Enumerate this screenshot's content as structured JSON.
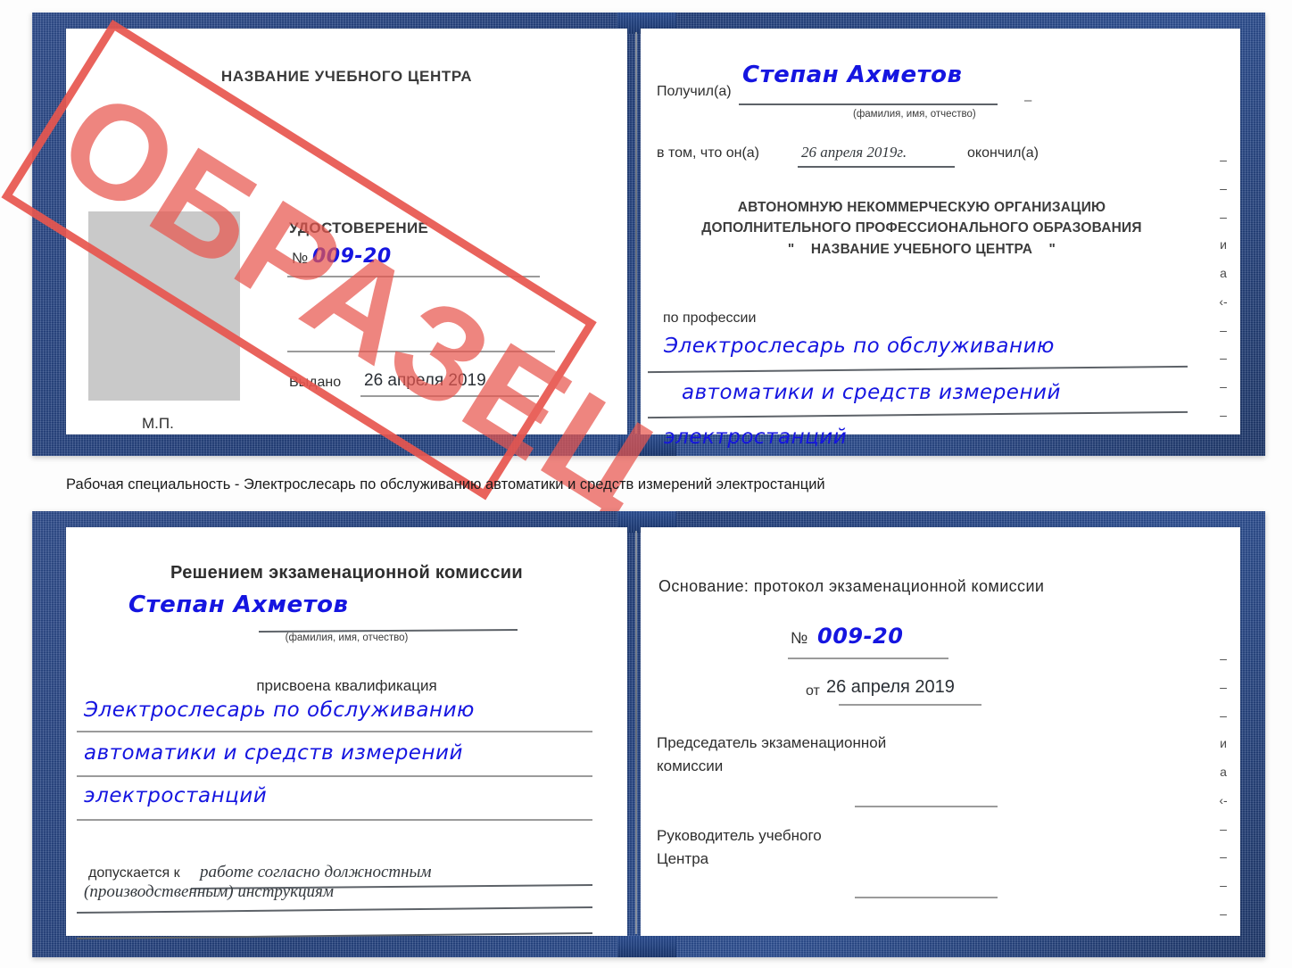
{
  "caption": {
    "text": "Рабочая специальность - Электрослесарь по обслуживанию автоматики и средств измерений электростанций"
  },
  "stamp": {
    "text": "ОБРАЗЕЦ",
    "color": "#e8564f"
  },
  "colors": {
    "cover_blue": "#1f3d7a",
    "ink_blue": "#1515e0",
    "paper_white": "#ffffff",
    "photo_gray": "#c9c9c9",
    "rule_gray": "#9b9b9b"
  },
  "certificate_top": {
    "left_page": {
      "center_name": "НАЗВАНИЕ УЧЕБНОГО ЦЕНТРА",
      "doc_type": "УДОСТОВЕРЕНИЕ",
      "number_prefix": "№",
      "number_value": "009-20",
      "issued_label": "Выдано",
      "issued_value": "26 апреля 2019",
      "seal_label": "М.П."
    },
    "right_page": {
      "received_label": "Получил(а)",
      "received_value": "Степан Ахметов",
      "fio_hint": "(фамилия, имя, отчество)",
      "in_that_label": "в том, что он(а)",
      "completion_date": "26 апреля 2019г.",
      "finished_label": "окончил(а)",
      "org_line1": "АВТОНОМНУЮ НЕКОММЕРЧЕСКУЮ ОРГАНИЗАЦИЮ",
      "org_line2": "ДОПОЛНИТЕЛЬНОГО ПРОФЕССИОНАЛЬНОГО ОБРАЗОВАНИЯ",
      "org_quote_open": "\"",
      "org_line3": "НАЗВАНИЕ УЧЕБНОГО ЦЕНТРА",
      "org_quote_close": "\"",
      "profession_label": "по профессии",
      "profession_line1": "Электрослесарь по обслуживанию",
      "profession_line2": "автоматики и средств измерений",
      "profession_line3": "электростанций",
      "edge_marks": [
        "–",
        "–",
        "–",
        "и",
        "а",
        "‹-",
        "–",
        "–",
        "–",
        "–"
      ]
    }
  },
  "certificate_bottom": {
    "left_page": {
      "decision_title": "Решением экзаменационной комиссии",
      "name_value": "Степан Ахметов",
      "fio_hint": "(фамилия, имя, отчество)",
      "qualification_label": "присвоена квалификация",
      "qualification_line1": "Электрослесарь по обслуживанию",
      "qualification_line2": "автоматики и средств измерений",
      "qualification_line3": "электростанций",
      "admitted_label": "допускается к",
      "admitted_line1": "работе согласно должностным",
      "admitted_line2": "(производственным) инструкциям"
    },
    "right_page": {
      "basis_label": "Основание: протокол экзаменационной комиссии",
      "number_prefix": "№",
      "number_value": "009-20",
      "from_label": "от",
      "from_value": "26 апреля 2019",
      "chairman_line1": "Председатель экзаменационной",
      "chairman_line2": "комиссии",
      "director_line1": "Руководитель учебного",
      "director_line2": "Центра",
      "edge_marks": [
        "–",
        "–",
        "–",
        "и",
        "а",
        "‹-",
        "–",
        "–",
        "–",
        "–"
      ]
    }
  }
}
